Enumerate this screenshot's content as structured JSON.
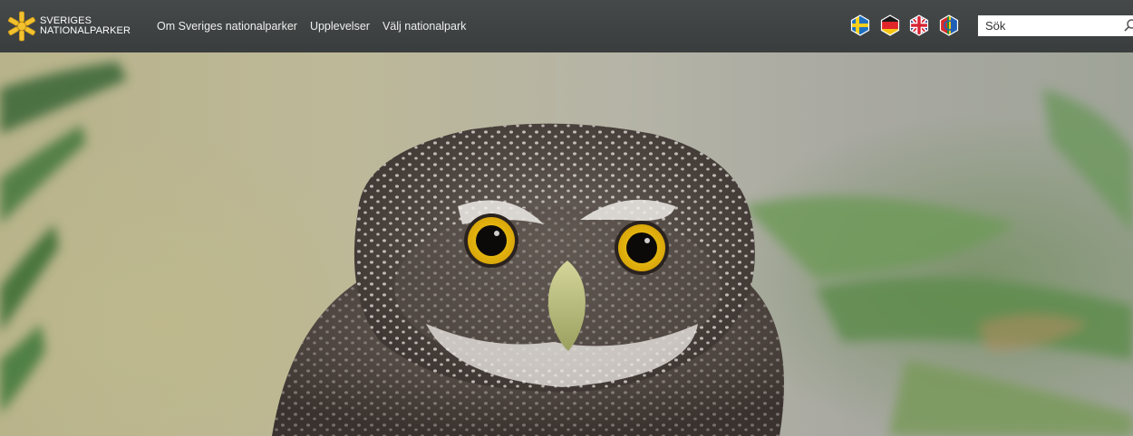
{
  "header": {
    "logo": {
      "line1": "SVERIGES",
      "line2": "NATIONALPARKER"
    },
    "nav": [
      {
        "label": "Om Sveriges nationalparker"
      },
      {
        "label": "Upplevelser"
      },
      {
        "label": "Välj nationalpark"
      }
    ],
    "languages": [
      {
        "icon": "flag-sweden-icon"
      },
      {
        "icon": "flag-germany-icon"
      },
      {
        "icon": "flag-uk-icon"
      },
      {
        "icon": "flag-sami-icon"
      }
    ],
    "search": {
      "placeholder": "Sök",
      "value": ""
    }
  },
  "hero": {
    "image": "pygmy-owl-photo"
  },
  "colors": {
    "header_bg": "#3f4242",
    "nav_text": "#eef0ee",
    "logo_star": "#f2c12e"
  }
}
